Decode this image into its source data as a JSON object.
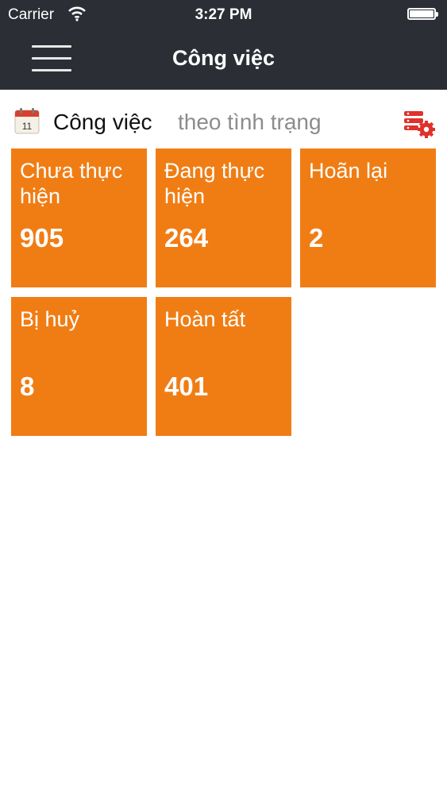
{
  "status_bar": {
    "carrier": "Carrier",
    "time": "3:27 PM"
  },
  "nav": {
    "title": "Công việc",
    "menu_icon": "hamburger-menu-icon"
  },
  "section": {
    "title": "Công việc",
    "subtitle": "theo tình trạng",
    "calendar_icon": "calendar-icon",
    "calendar_day": "11",
    "settings_icon": "settings-icon"
  },
  "accent_color": "#f07d14",
  "tiles": [
    {
      "label": "Chưa thực hiện",
      "count": "905"
    },
    {
      "label": "Đang thực hiện",
      "count": "264"
    },
    {
      "label": "Hoãn lại",
      "count": "2"
    },
    {
      "label": "Bị huỷ",
      "count": "8"
    },
    {
      "label": "Hoàn tất",
      "count": "401"
    }
  ]
}
